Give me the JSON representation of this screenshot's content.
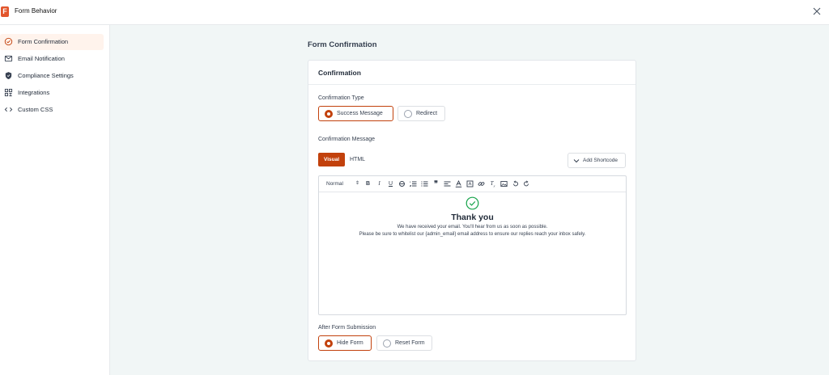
{
  "app": {
    "logo_letter": "F",
    "title": "Form Behavior"
  },
  "sidebar": {
    "items": [
      {
        "label": "Form Confirmation",
        "icon": "check-circle-icon",
        "active": true
      },
      {
        "label": "Email Notification",
        "icon": "envelope-icon",
        "active": false
      },
      {
        "label": "Compliance Settings",
        "icon": "shield-icon",
        "active": false
      },
      {
        "label": "Integrations",
        "icon": "grid-icon",
        "active": false
      },
      {
        "label": "Custom CSS",
        "icon": "code-icon",
        "active": false
      }
    ]
  },
  "main": {
    "page_title": "Form Confirmation",
    "card_title": "Confirmation",
    "confirmation_type": {
      "label": "Confirmation Type",
      "options": [
        {
          "label": "Success Message",
          "selected": true
        },
        {
          "label": "Redirect",
          "selected": false
        }
      ]
    },
    "confirmation_message": {
      "label": "Confirmation Message",
      "tabs": [
        {
          "label": "Visual",
          "active": true
        },
        {
          "label": "HTML",
          "active": false
        }
      ],
      "add_shortcode_label": "Add Shortcode"
    },
    "editor": {
      "format_select": "Normal",
      "content": {
        "heading": "Thank you",
        "line1": "We have received your email. You'll hear from us as soon as possible.",
        "line2": "Please be sure to whitelist our {admin_email} email address to ensure our replies reach your inbox safely."
      }
    },
    "after_submission": {
      "label": "After Form Submission",
      "options": [
        {
          "label": "Hide Form",
          "selected": true
        },
        {
          "label": "Reset Form",
          "selected": false
        }
      ]
    }
  },
  "colors": {
    "accent": "#c2410c",
    "success": "#16a34a",
    "active_bg": "#fff3ec",
    "page_bg": "#f1f6f6"
  }
}
